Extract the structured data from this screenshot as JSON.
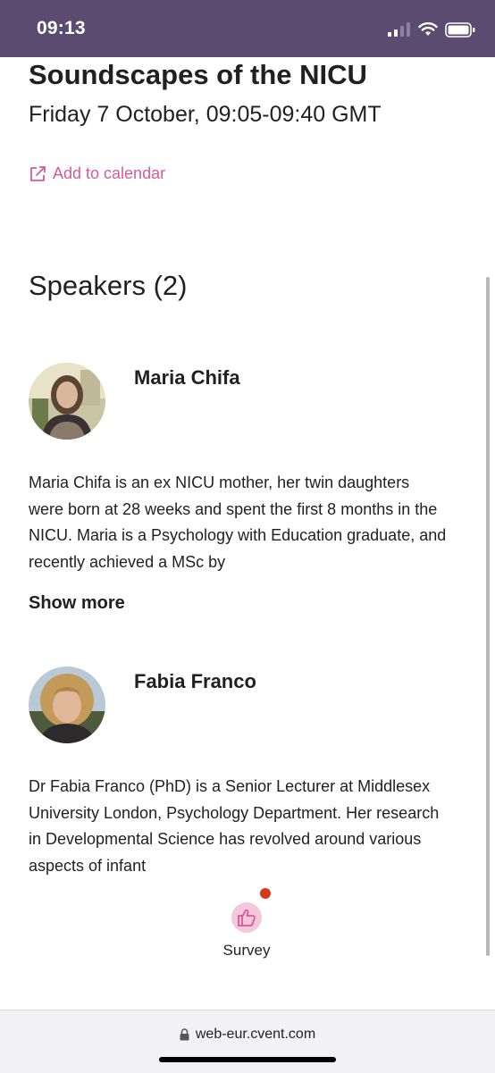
{
  "status_bar": {
    "time": "09:13",
    "icons": [
      "signal-icon",
      "wifi-icon",
      "battery-icon"
    ]
  },
  "event": {
    "title": "Soundscapes of the NICU",
    "datetime": "Friday 7 October, 09:05-09:40 GMT",
    "add_to_calendar": "Add to calendar"
  },
  "speakers": {
    "heading": "Speakers (2)",
    "items": [
      {
        "name": "Maria Chifa",
        "bio": "Maria Chifa is an ex NICU mother, her twin daughters were born at 28 weeks and spent the first 8 months in the NICU. Maria is a Psychology with Education graduate, and recently achieved a MSc by",
        "show_more": "Show more"
      },
      {
        "name": "Fabia Franco",
        "bio": "Dr Fabia Franco (PhD) is a Senior Lecturer at Middlesex University London, Psychology Department. Her research in Developmental Science has revolved around various aspects of infant"
      }
    ]
  },
  "survey": {
    "label": "Survey",
    "icon": "thumbs-up-icon"
  },
  "browser": {
    "url": "web-eur.cvent.com",
    "icon": "lock-icon"
  },
  "colors": {
    "status_bar": "#5c4b71",
    "accent": "#d65a9a",
    "notification": "#d43a1f"
  }
}
